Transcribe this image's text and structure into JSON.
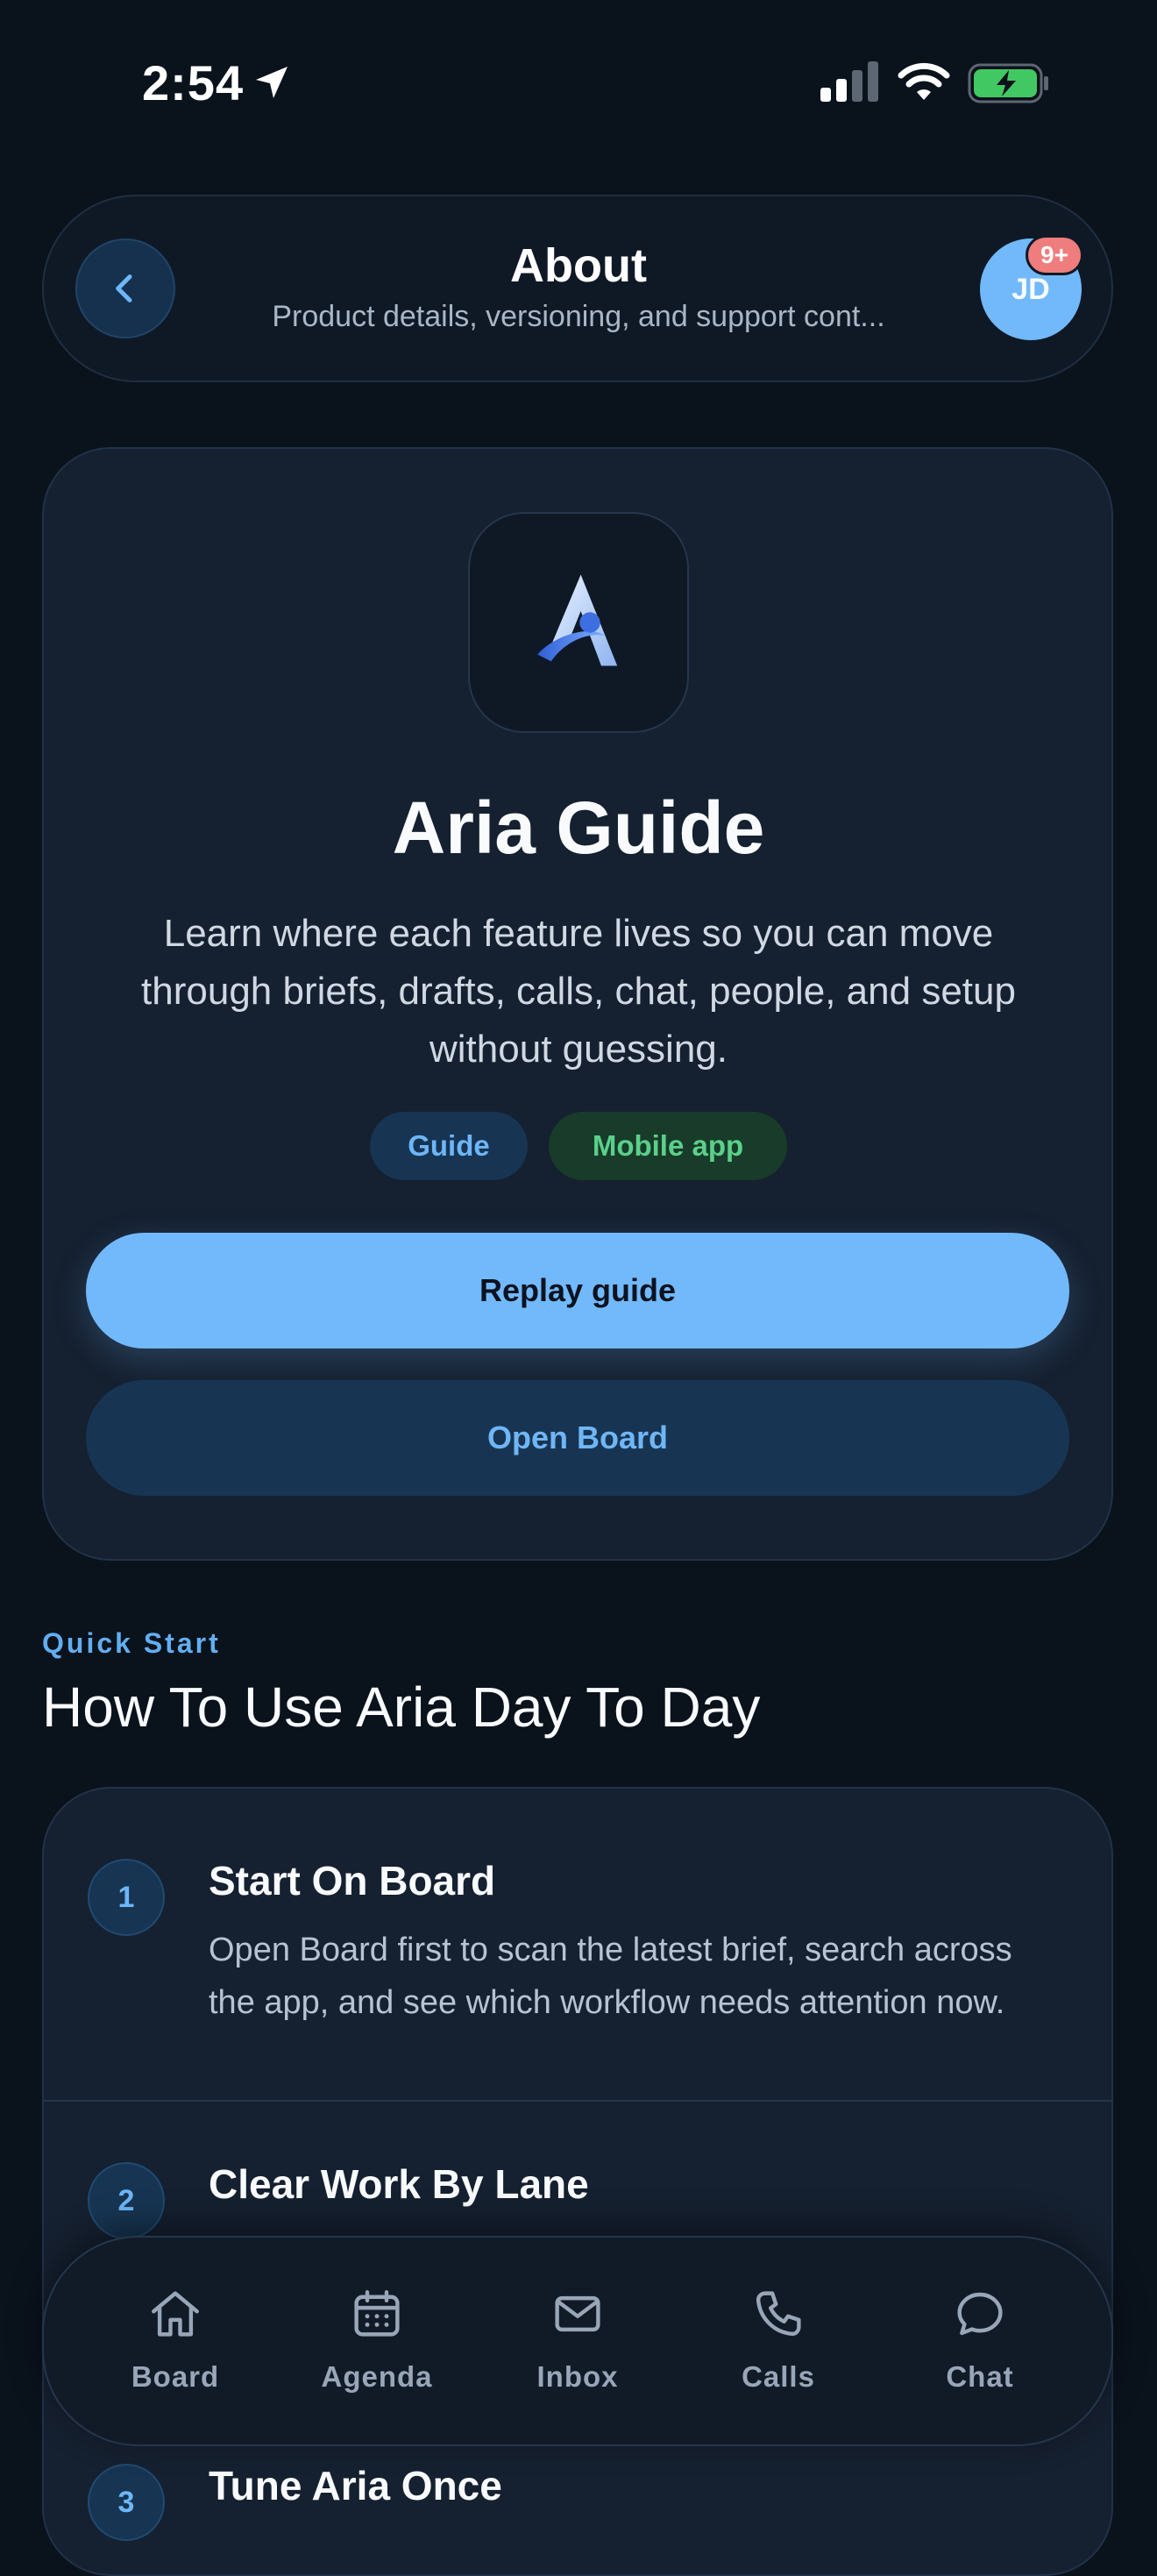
{
  "status_bar": {
    "time": "2:54"
  },
  "header": {
    "title": "About",
    "subtitle": "Product details, versioning, and support cont...",
    "avatar_initials": "JD",
    "notification_badge": "9+"
  },
  "hero": {
    "app_name": "Aria Guide",
    "description": "Learn where each feature lives so you can move through briefs, drafts, calls, chat, people, and setup without guessing.",
    "chips": [
      "Guide",
      "Mobile app"
    ],
    "primary_button": "Replay guide",
    "secondary_button": "Open Board"
  },
  "quick_start": {
    "eyebrow": "Quick Start",
    "title": "How To Use Aria Day To Day",
    "steps": [
      {
        "number": "1",
        "title": "Start On Board",
        "body": "Open Board first to scan the latest brief, search across the app, and see which workflow needs attention now."
      },
      {
        "number": "2",
        "title": "Clear Work By Lane",
        "body": ""
      },
      {
        "number": "3",
        "title": "Tune Aria Once",
        "body": ""
      }
    ]
  },
  "tabbar": {
    "items": [
      {
        "label": "Board",
        "icon": "home-icon"
      },
      {
        "label": "Agenda",
        "icon": "calendar-icon"
      },
      {
        "label": "Inbox",
        "icon": "mail-icon"
      },
      {
        "label": "Calls",
        "icon": "phone-icon"
      },
      {
        "label": "Chat",
        "icon": "chat-bubble-icon"
      }
    ]
  },
  "colors": {
    "background": "#0a121c",
    "accent": "#72b9fb",
    "card": "#152030",
    "success": "#5bd08a",
    "badge": "#ef7d7d"
  }
}
